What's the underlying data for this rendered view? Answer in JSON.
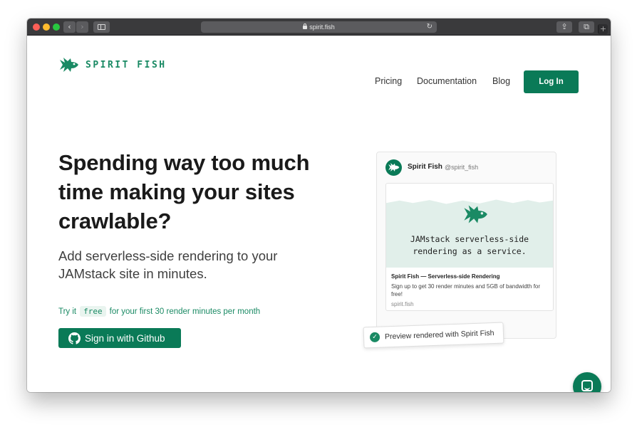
{
  "browser": {
    "url": "spirit.fish"
  },
  "header": {
    "logo_text": "SPIRIT FISH",
    "nav": [
      {
        "label": "Pricing"
      },
      {
        "label": "Documentation"
      },
      {
        "label": "Blog"
      }
    ],
    "login_label": "Log In"
  },
  "hero": {
    "headline": "Spending way too much time making your sites crawlable?",
    "subhead": "Add serverless-side rendering to your JAMstack site in minutes.",
    "trial_prefix": "Try it",
    "trial_free": "free",
    "trial_suffix": "for your first 30 render minutes per month",
    "github_button": "Sign in with Github"
  },
  "tweet_card": {
    "name": "Spirit Fish",
    "handle": "@spirit_fish",
    "preview": {
      "tagline": "JAMstack serverless-side rendering as a service.",
      "title": "Spirit Fish — Serverless-side Rendering",
      "description": "Sign up to get 30 render minutes and 5GB of bandwidth for free!",
      "url": "spirit.fish"
    },
    "badge": "Preview rendered with Spirit Fish"
  },
  "colors": {
    "brand": "#0a7a57",
    "brand_text": "#1a8a64",
    "preview_bg": "#e1efea"
  }
}
